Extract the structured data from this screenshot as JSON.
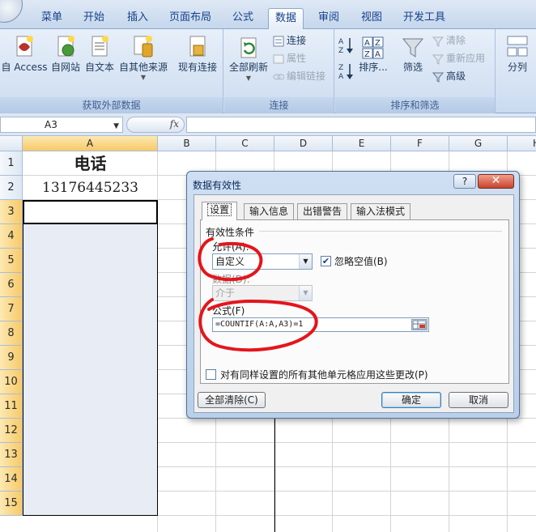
{
  "ribbon_tabs": [
    "菜单",
    "开始",
    "插入",
    "页面布局",
    "公式",
    "数据",
    "审阅",
    "视图",
    "开发工具"
  ],
  "active_tab": "数据",
  "groups": {
    "external": {
      "label": "获取外部数据",
      "buttons": [
        "自 Access",
        "自网站",
        "自文本",
        "自其他来源",
        "现有连接"
      ]
    },
    "connections": {
      "label": "连接",
      "refresh_all": "全部刷新",
      "items": [
        "连接",
        "属性",
        "编辑链接"
      ]
    },
    "sort_filter": {
      "label": "排序和筛选",
      "sort": "排序...",
      "filter": "筛选",
      "items": [
        "清除",
        "重新应用",
        "高级"
      ]
    },
    "tools": {
      "split": "分列"
    }
  },
  "formula_bar": {
    "name_box": "A3",
    "fx": "fx",
    "formula": ""
  },
  "columns": [
    "A",
    "B",
    "C",
    "D",
    "E",
    "F",
    "G",
    "H"
  ],
  "rows": [
    "1",
    "2",
    "3",
    "4",
    "5",
    "6",
    "7",
    "8",
    "9",
    "10",
    "11",
    "12",
    "13",
    "14",
    "15"
  ],
  "cells": {
    "A1": "电话",
    "A2": "13176445233"
  },
  "dialog": {
    "title": "数据有效性",
    "help": "?",
    "close": "✕",
    "tabs": [
      "设置",
      "输入信息",
      "出错警告",
      "输入法模式"
    ],
    "active_tab": "设置",
    "section": "有效性条件",
    "allow_label": "允许(A):",
    "allow_value": "自定义",
    "ignore_blank_label": "忽略空值(B)",
    "ignore_blank_checked": true,
    "data_label": "数据(D):",
    "data_value": "介于",
    "formula_label": "公式(F)",
    "formula_value": "=COUNTIF(A:A,A3)=1",
    "apply_all_label": "对有同样设置的所有其他单元格应用这些更改(P)",
    "apply_all_checked": false,
    "clear_all": "全部清除(C)",
    "ok": "确定",
    "cancel": "取消"
  },
  "colors": {
    "annotation": "#e4151c",
    "selection": "#e8ecf5",
    "selected_header": "#f7c968"
  }
}
